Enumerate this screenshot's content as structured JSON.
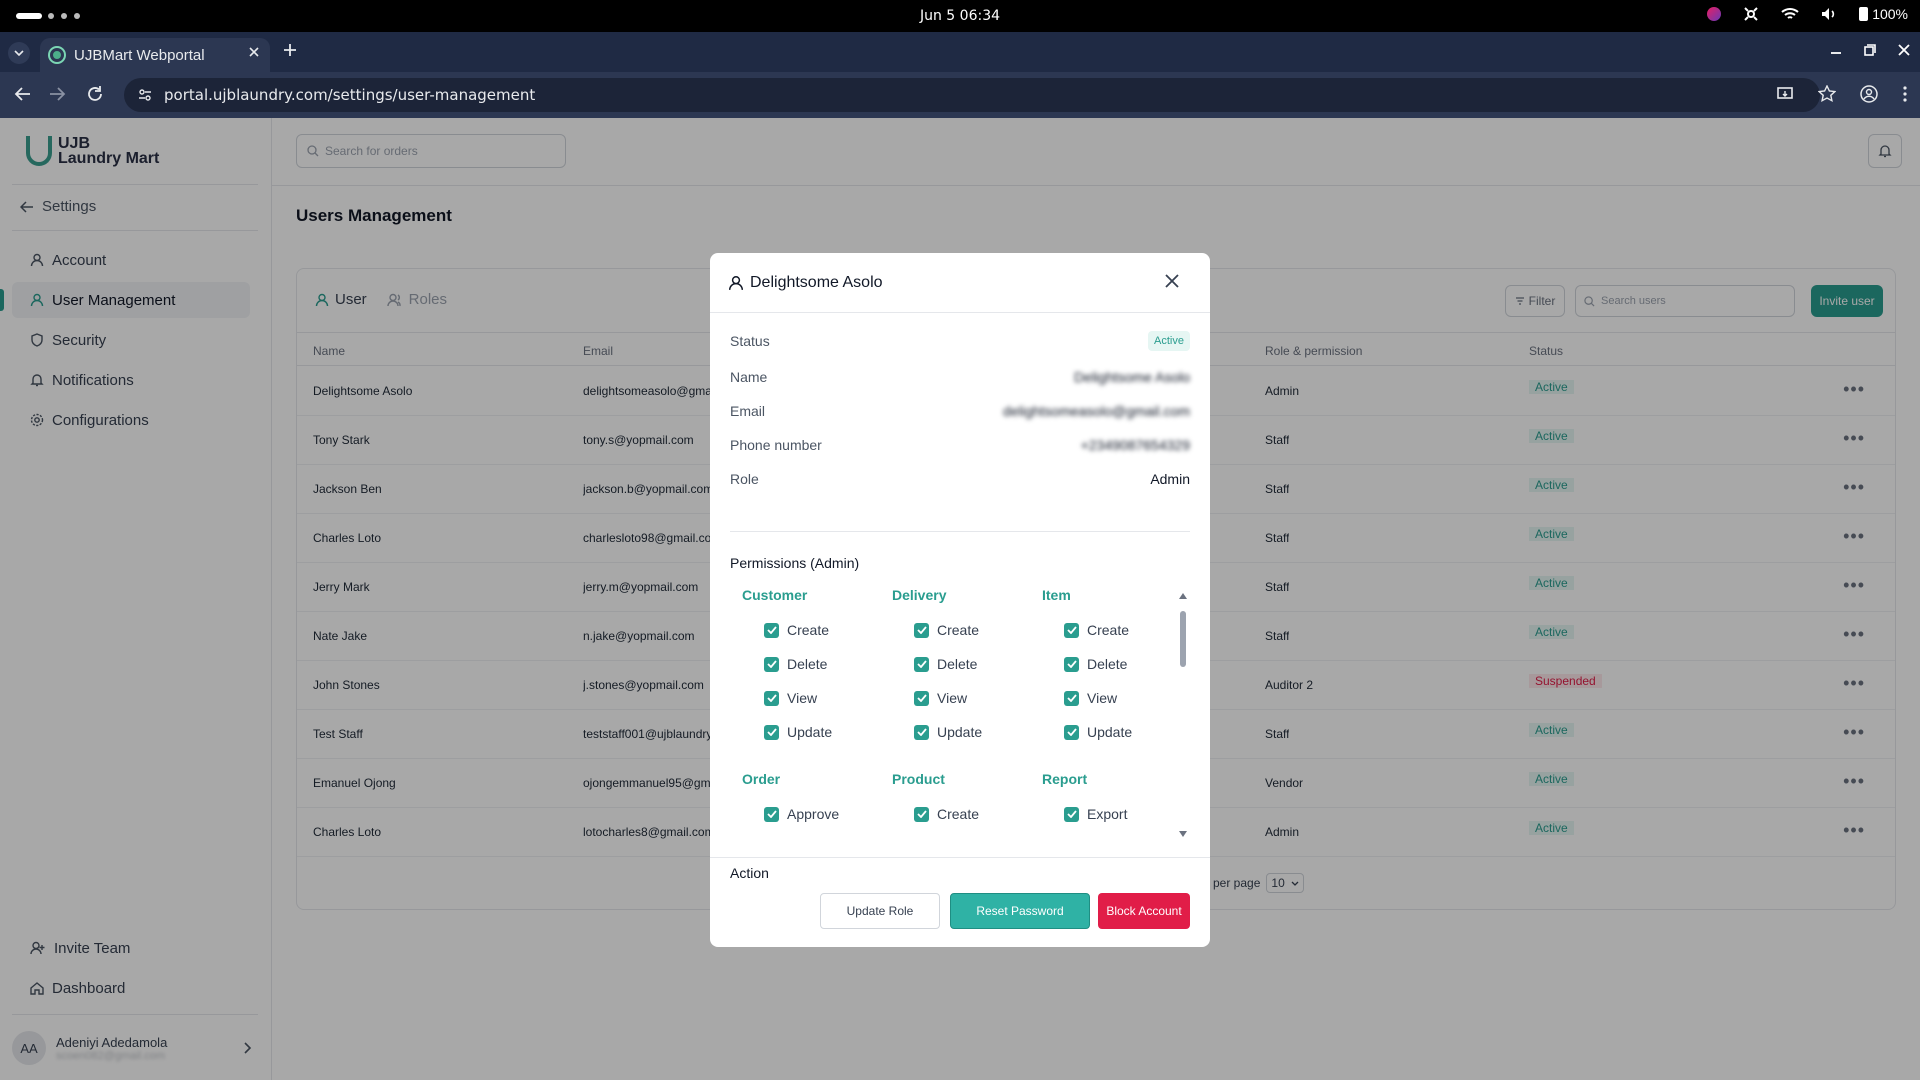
{
  "os": {
    "datetime": "Jun 5  06:34",
    "battery": "100%"
  },
  "browser": {
    "tab_title": "UJBMart Webportal",
    "url": "portal.ujblaundry.com/settings/user-management"
  },
  "sidebar": {
    "logo": {
      "line1": "UJB",
      "line2": "Laundry Mart"
    },
    "back_label": "Settings",
    "items": [
      {
        "label": "Account",
        "icon": "person-icon"
      },
      {
        "label": "User Management",
        "icon": "person-icon",
        "active": true
      },
      {
        "label": "Security",
        "icon": "shield-icon"
      },
      {
        "label": "Notifications",
        "icon": "bell-icon"
      },
      {
        "label": "Configurations",
        "icon": "gear-icon"
      }
    ],
    "bottom": [
      {
        "label": "Invite Team",
        "icon": "person-add-icon"
      },
      {
        "label": "Dashboard",
        "icon": "home-icon"
      }
    ],
    "user": {
      "initials": "AA",
      "name": "Adeniyi Adedamola",
      "email": "scoen082@gmail.com"
    }
  },
  "header": {
    "search_placeholder": "Search for orders"
  },
  "page": {
    "title": "Users Management"
  },
  "card": {
    "tabs": [
      "User",
      "Roles"
    ],
    "filter_label": "Filter",
    "search_placeholder": "Search users",
    "invite_label": "Invite user",
    "columns": [
      "Name",
      "Email",
      "Role & permission",
      "Status"
    ],
    "rows": [
      {
        "name": "Delightsome Asolo",
        "email": "delightsomeasolo@gmail.com",
        "role": "Admin",
        "status": "Active"
      },
      {
        "name": "Tony Stark",
        "email": "tony.s@yopmail.com",
        "role": "Staff",
        "status": "Active"
      },
      {
        "name": "Jackson Ben",
        "email": "jackson.b@yopmail.com",
        "role": "Staff",
        "status": "Active"
      },
      {
        "name": "Charles Loto",
        "email": "charlesloto98@gmail.com",
        "role": "Staff",
        "status": "Active"
      },
      {
        "name": "Jerry Mark",
        "email": "jerry.m@yopmail.com",
        "role": "Staff",
        "status": "Active"
      },
      {
        "name": "Nate Jake",
        "email": "n.jake@yopmail.com",
        "role": "Staff",
        "status": "Active"
      },
      {
        "name": "John Stones",
        "email": "j.stones@yopmail.com",
        "role": "Auditor 2",
        "status": "Suspended"
      },
      {
        "name": "Test Staff",
        "email": "teststaff001@ujblaundry.com",
        "role": "Staff",
        "status": "Active"
      },
      {
        "name": "Emanuel Ojong",
        "email": "ojongemmanuel95@gmail.com",
        "role": "Vendor",
        "status": "Active"
      },
      {
        "name": "Charles Loto",
        "email": "lotocharles8@gmail.com",
        "role": "Admin",
        "status": "Active"
      }
    ],
    "records_label": "rds per page",
    "per_page": "10"
  },
  "modal": {
    "title": "Delightsome Asolo",
    "status_label": "Status",
    "status_value": "Active",
    "name_label": "Name",
    "name_value": "Delightsome Asolo",
    "email_label": "Email",
    "email_value": "delightsomeasolo@gmail.com",
    "phone_label": "Phone number",
    "phone_value": "+2349087654329",
    "role_label": "Role",
    "role_value": "Admin",
    "permissions_title": "Permissions (Admin)",
    "groups": [
      {
        "title": "Customer",
        "perms": [
          "Create",
          "Delete",
          "View",
          "Update"
        ]
      },
      {
        "title": "Delivery",
        "perms": [
          "Create",
          "Delete",
          "View",
          "Update"
        ]
      },
      {
        "title": "Item",
        "perms": [
          "Create",
          "Delete",
          "View",
          "Update"
        ]
      },
      {
        "title": "Order",
        "perms": [
          "Approve"
        ]
      },
      {
        "title": "Product",
        "perms": [
          "Create"
        ]
      },
      {
        "title": "Report",
        "perms": [
          "Export"
        ]
      }
    ],
    "action_label": "Action",
    "buttons": {
      "update_role": "Update Role",
      "reset_password": "Reset Password",
      "block_account": "Block Account"
    }
  },
  "colors": {
    "accent": "#2a9d8f",
    "active_badge_bg": "#e6f6f3",
    "suspended_badge_bg": "#fde8ec",
    "danger": "#e11d48"
  }
}
